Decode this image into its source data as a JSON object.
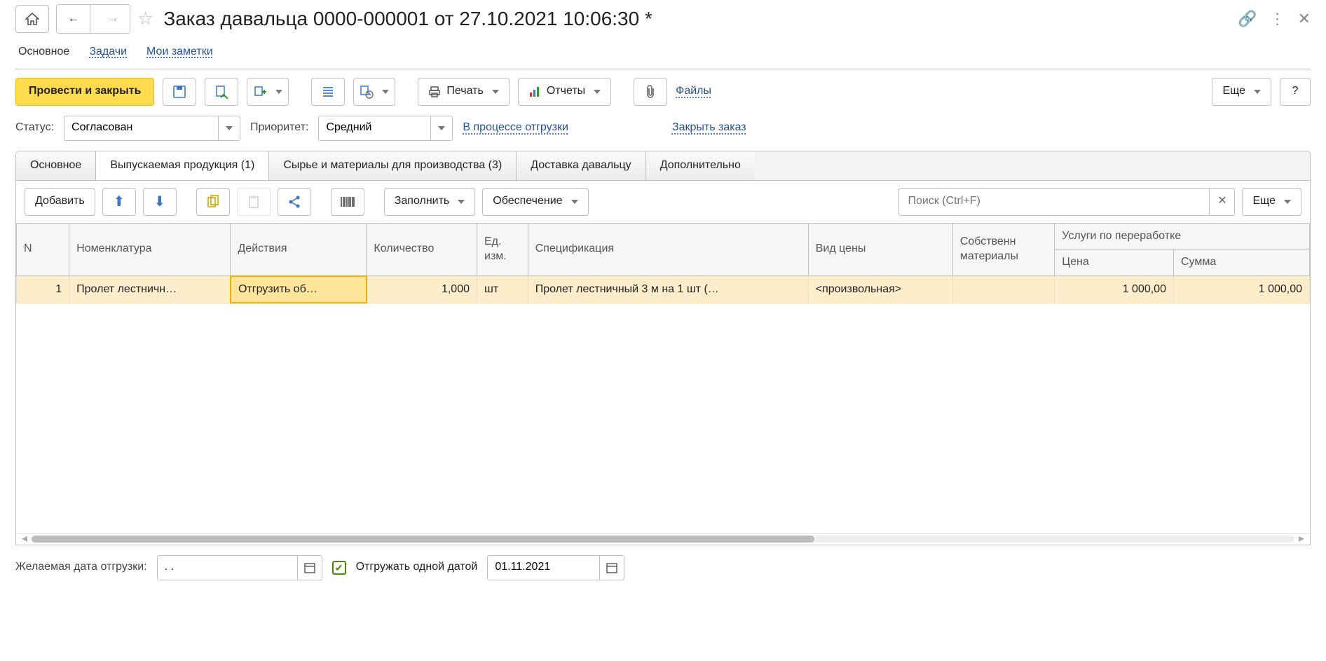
{
  "header": {
    "title": "Заказ давальца 0000-000001 от 27.10.2021 10:06:30 *"
  },
  "navTabs": {
    "main": "Основное",
    "tasks": "Задачи",
    "notes": "Мои заметки"
  },
  "toolbar": {
    "commit": "Провести и закрыть",
    "print": "Печать",
    "reports": "Отчеты",
    "files": "Файлы",
    "more": "Еще",
    "help": "?"
  },
  "status": {
    "label": "Статус:",
    "value": "Согласован",
    "priorityLabel": "Приоритет:",
    "priorityValue": "Средний",
    "shipping": "В процессе отгрузки",
    "close": "Закрыть заказ"
  },
  "docTabs": {
    "basic": "Основное",
    "products": "Выпускаемая продукция (1)",
    "materials": "Сырье и материалы для производства (3)",
    "delivery": "Доставка давальцу",
    "extra": "Дополнительно"
  },
  "tb2": {
    "add": "Добавить",
    "fill": "Заполнить",
    "ensure": "Обеспечение",
    "search_ph": "Поиск (Ctrl+F)",
    "more": "Еще"
  },
  "cols": {
    "n": "N",
    "nomen": "Номенклатура",
    "actions": "Действия",
    "qty": "Количество",
    "unit": "Ед. изм.",
    "spec": "Спецификация",
    "priceType": "Вид цены",
    "ownMat": "Собственн материалы",
    "processing": "Услуги по переработке",
    "price": "Цена",
    "sum": "Сумма"
  },
  "rows": [
    {
      "n": "1",
      "nomen": "Пролет лестничн…",
      "actions": "Отгрузить об…",
      "qty": "1,000",
      "unit": "шт",
      "spec": "Пролет лестничный 3 м на 1 шт (…",
      "priceType": "<произвольная>",
      "ownMat": "",
      "price": "1 000,00",
      "sum": "1 000,00"
    }
  ],
  "footer": {
    "desiredLabel": "Желаемая дата отгрузки:",
    "desiredDate": ". .",
    "oneDate": "Отгружать одной датой",
    "shipDate": "01.11.2021"
  }
}
